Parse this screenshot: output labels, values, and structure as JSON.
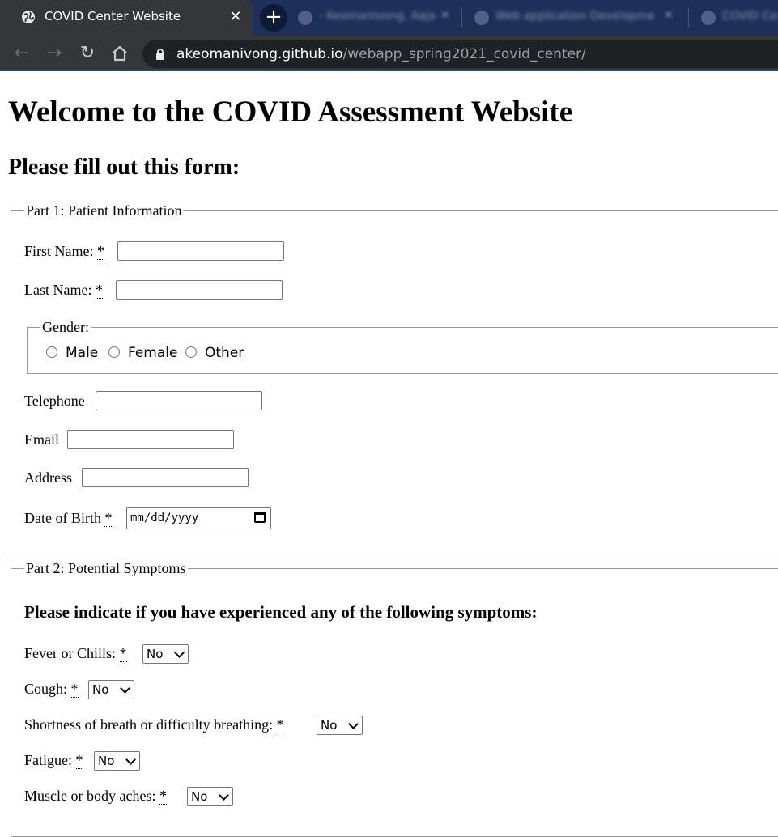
{
  "browser": {
    "active_tab_title": "COVID Center Website",
    "background_tabs": [
      "- Keomanivong, Aaja - C",
      "Web application Developme",
      "COVID Cen"
    ],
    "url_host": "akeomanivong.github.io",
    "url_path": "/webapp_spring2021_covid_center/"
  },
  "page": {
    "title": "Welcome to the COVID Assessment Website",
    "subtitle": "Please fill out this form:"
  },
  "part1": {
    "legend": "Part 1: Patient Information",
    "first_name_label": "First Name:",
    "last_name_label": "Last Name:",
    "required_mark": "*",
    "gender_legend": "Gender:",
    "gender_options": [
      "Male",
      "Female",
      "Other"
    ],
    "telephone_label": "Telephone",
    "email_label": "Email",
    "address_label": "Address",
    "dob_label": "Date of Birth",
    "dob_placeholder": "mm/dd/yyyy"
  },
  "part2": {
    "legend": "Part 2: Potential Symptoms",
    "heading": "Please indicate if you have experienced any of the following symptoms:",
    "symptoms": [
      {
        "label": "Fever or Chills:",
        "value": "No"
      },
      {
        "label": "Cough:",
        "value": "No"
      },
      {
        "label": "Shortness of breath or difficulty breathing:",
        "value": "No"
      },
      {
        "label": "Fatigue:",
        "value": "No"
      },
      {
        "label": "Muscle or body aches:",
        "value": "No"
      }
    ]
  }
}
